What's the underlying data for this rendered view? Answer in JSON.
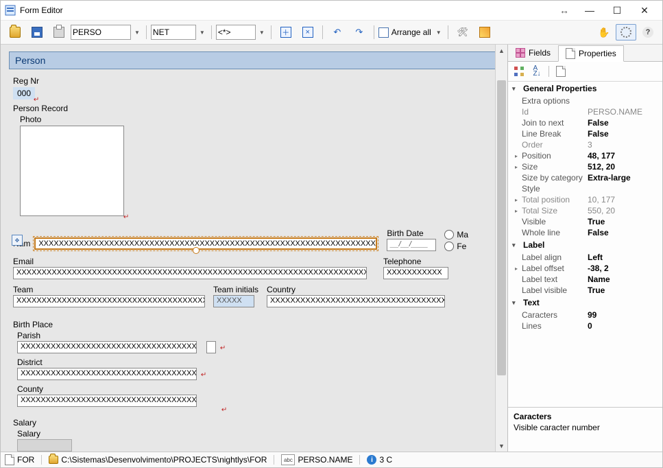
{
  "window": {
    "title": "Form Editor"
  },
  "toolbar": {
    "combo_table": "PERSO",
    "combo_lang": "NET",
    "combo_mode": "<*>",
    "arrange_label": "Arrange all"
  },
  "form": {
    "header_title": "Person",
    "reg_label": "Reg Nr",
    "reg_value": "000",
    "person_record_label": "Person Record",
    "photo_label": "Photo",
    "name_label": "Nam",
    "name_content": "XXXXXXXXXXXXXXXXXXXXXXXXXXXXXXXXXXXXXXXXXXXXXXXXXXXXXXXXXXXXXXXXXXXXXXXXXXXXXXXXXXXXXXXXXXXXXXXXXXX",
    "birthdate_label": "Birth Date",
    "birthdate_value": "__/__/____",
    "radio_male": "Ma",
    "radio_female": "Fe",
    "email_label": "Email",
    "email_value": "XXXXXXXXXXXXXXXXXXXXXXXXXXXXXXXXXXXXXXXXXXXXXXXXXXXXXXXXXXXXXXXXXXXXXXXXXXXXXXXXXXXXXXXXXXXXXXXXXXX",
    "telephone_label": "Telephone",
    "telephone_value": "XXXXXXXXXXX",
    "team_label": "Team",
    "team_value": "XXXXXXXXXXXXXXXXXXXXXXXXXXXXXXXXXXXXXXXXXXXXXXXXXX",
    "team_initials_label": "Team initials",
    "team_initials_value": "XXXXX",
    "country_label": "Country",
    "country_value": "XXXXXXXXXXXXXXXXXXXXXXXXXXXXXXXXXXXXXXXXXXXXXXXXXX",
    "birthplace_label": "Birth Place",
    "parish_label": "Parish",
    "parish_value": "XXXXXXXXXXXXXXXXXXXXXXXXXXXXXXXXXXXXXXXXXXXXXXXXXX",
    "district_label": "District",
    "district_value": "XXXXXXXXXXXXXXXXXXXXXXXXXXXXXXXXXXXXXXXXXXXXXXXXXX",
    "county_label": "County",
    "county_value": "XXXXXXXXXXXXXXXXXXXXXXXXXXXXXXXXXXXXXXXXXXXXXXXXXX",
    "salary_group_label": "Salary",
    "salary_label": "Salary"
  },
  "side": {
    "tab_fields": "Fields",
    "tab_properties": "Properties",
    "groups": {
      "general": "General Properties",
      "label": "Label",
      "text": "Text"
    },
    "props": {
      "extra_options_name": "Extra options",
      "extra_options_val": "",
      "id_name": "Id",
      "id_val": "PERSO.NAME",
      "join_name": "Join to next",
      "join_val": "False",
      "linebreak_name": "Line Break",
      "linebreak_val": "False",
      "order_name": "Order",
      "order_val": "3",
      "position_name": "Position",
      "position_val": "48, 177",
      "size_name": "Size",
      "size_val": "512, 20",
      "sizecat_name": "Size by category",
      "sizecat_val": "Extra-large",
      "style_name": "Style",
      "style_val": "",
      "totalpos_name": "Total position",
      "totalpos_val": "10, 177",
      "totalsize_name": "Total Size",
      "totalsize_val": "550, 20",
      "visible_name": "Visible",
      "visible_val": "True",
      "wholeline_name": "Whole line",
      "wholeline_val": "False",
      "labelalign_name": "Label align",
      "labelalign_val": "Left",
      "labeloffset_name": "Label offset",
      "labeloffset_val": "-38, 2",
      "labeltext_name": "Label text",
      "labeltext_val": "Name",
      "labelvisible_name": "Label visible",
      "labelvisible_val": "True",
      "caracters_name": "Caracters",
      "caracters_val": "99",
      "lines_name": "Lines",
      "lines_val": "0"
    },
    "desc_title": "Caracters",
    "desc_text": "Visible caracter number"
  },
  "status": {
    "seg1": "FOR",
    "path": "C:\\Sistemas\\Desenvolvimento\\PROJECTS\\nightlys\\FOR",
    "field_id": "PERSO.NAME",
    "coords": "3 C"
  }
}
